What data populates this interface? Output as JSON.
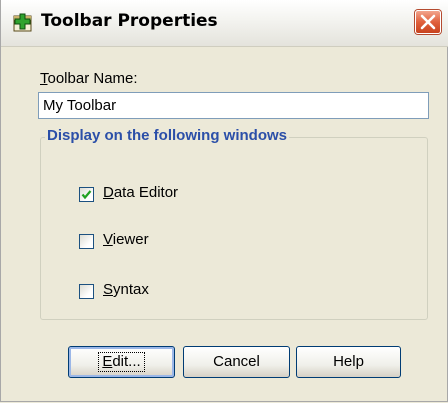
{
  "window": {
    "title": "Toolbar Properties",
    "close_icon": "close-icon",
    "app_icon": "toolbar-properties-icon"
  },
  "toolbar_name": {
    "label_prefix": "",
    "label_mnemonic": "T",
    "label_rest": "oolbar Name:",
    "value": "My Toolbar"
  },
  "display_group": {
    "legend": "Display on the following windows",
    "options": [
      {
        "mnemonic": "D",
        "rest": "ata Editor",
        "checked": true
      },
      {
        "mnemonic": "V",
        "rest": "iewer",
        "checked": false
      },
      {
        "mnemonic": "S",
        "rest": "yntax",
        "checked": false
      }
    ]
  },
  "buttons": {
    "edit": {
      "mnemonic": "E",
      "rest": "dit..."
    },
    "cancel": "Cancel",
    "help": "Help"
  },
  "colors": {
    "dialog_bg": "#ece9d8",
    "group_legend": "#2b4fa8",
    "close_button": "#e0613d"
  }
}
